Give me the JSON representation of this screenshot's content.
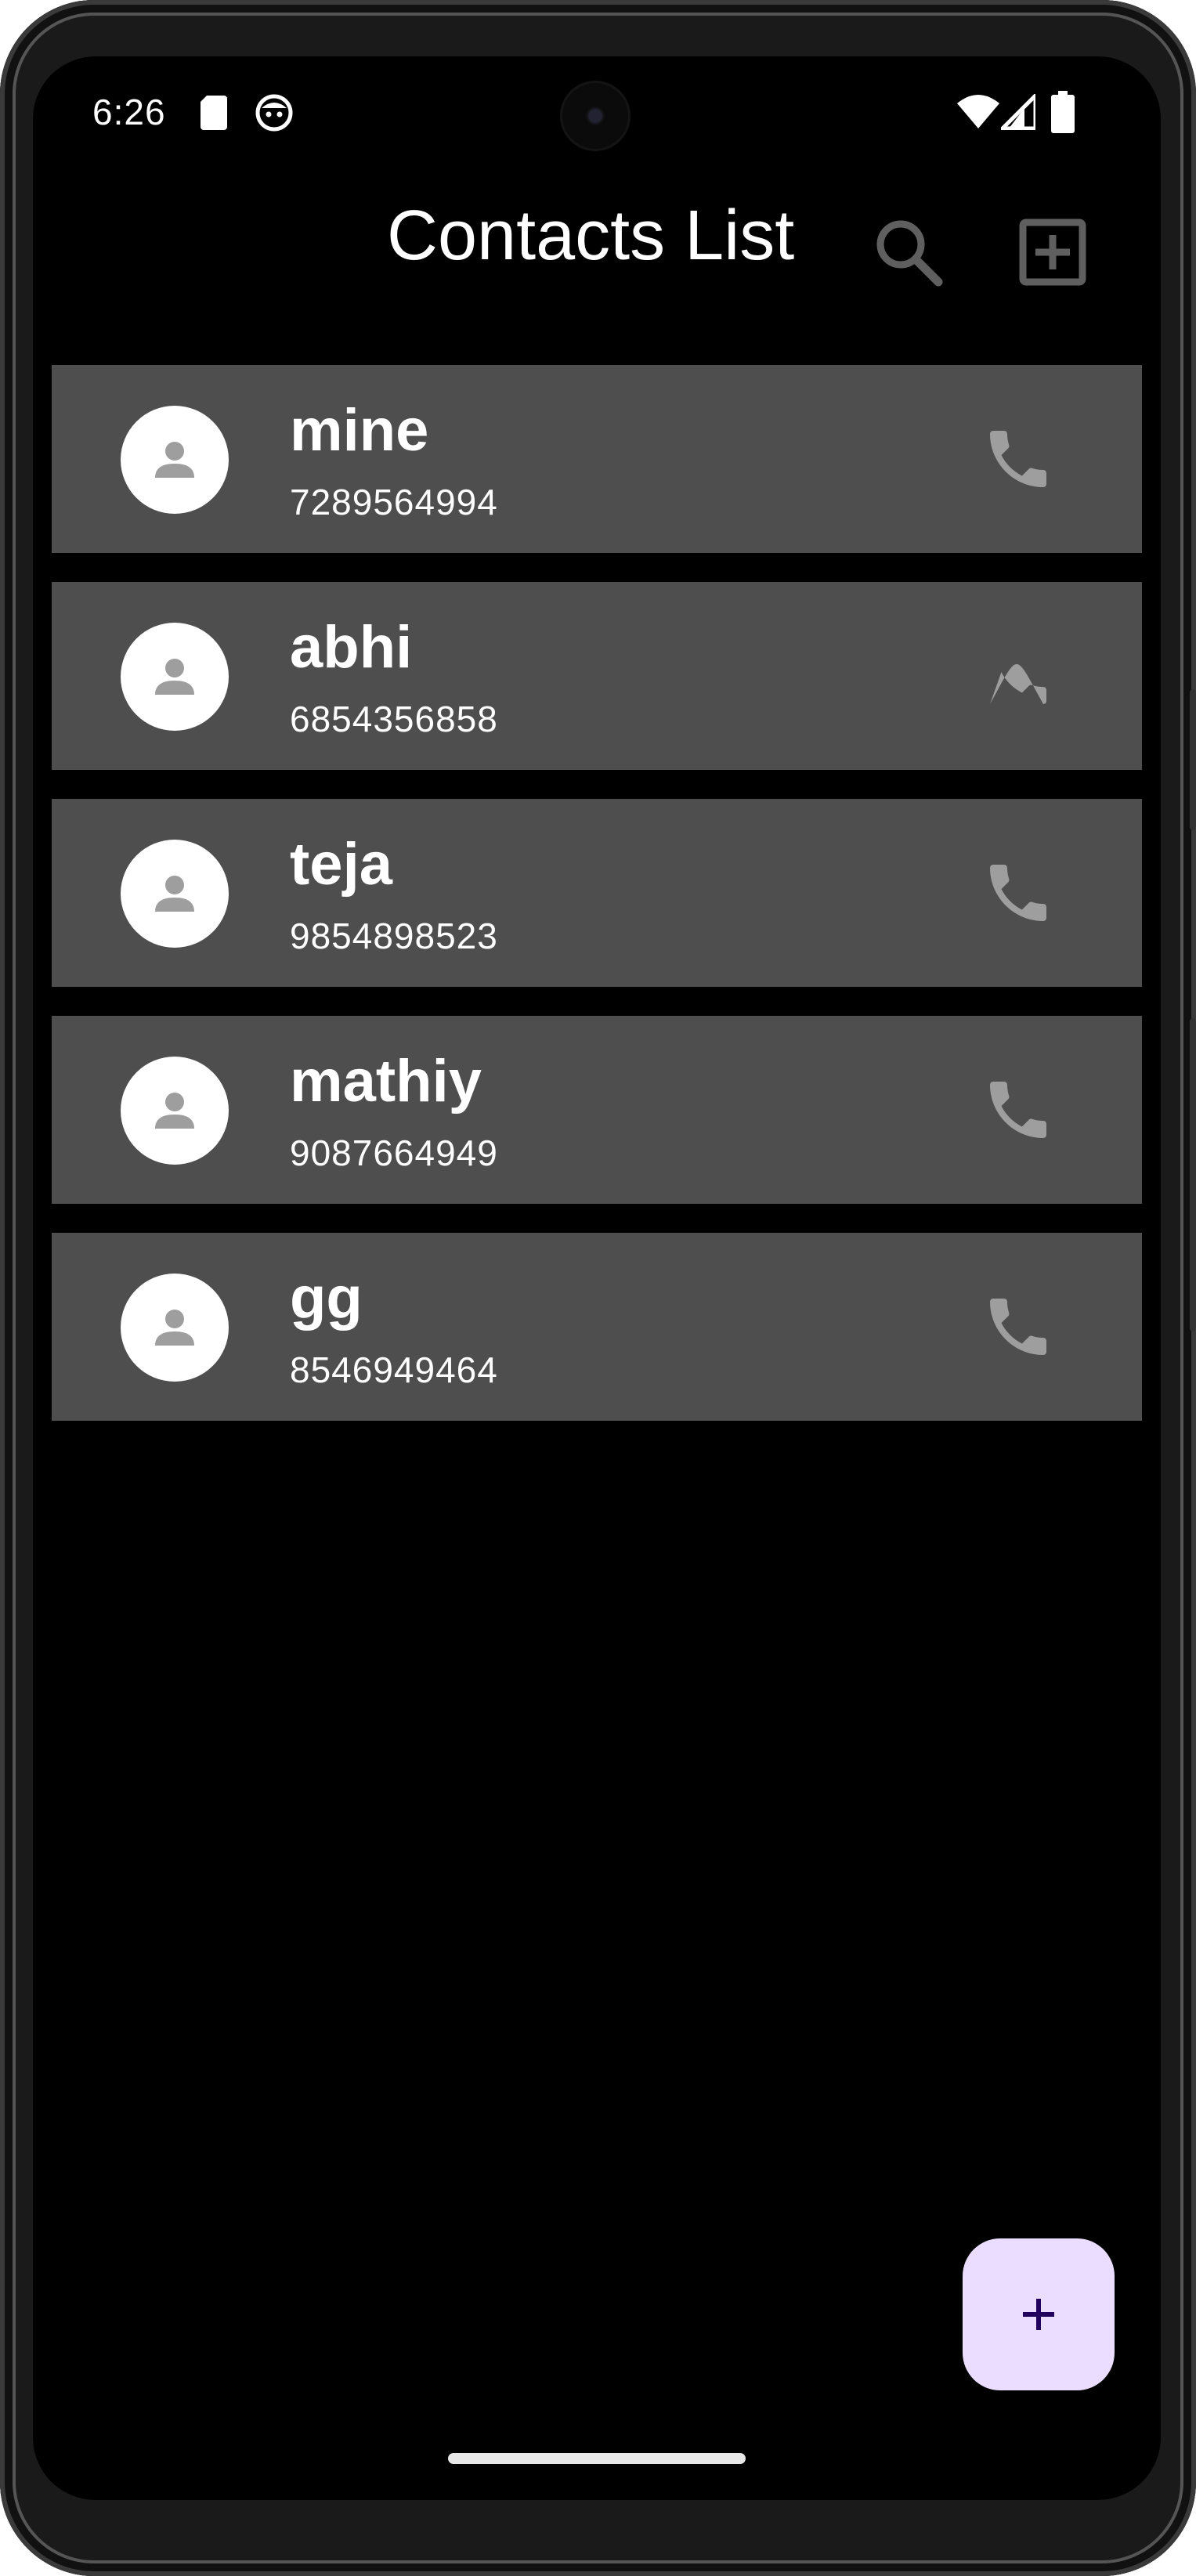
{
  "status_bar": {
    "time": "6:26",
    "icons": [
      "sd-card-icon",
      "face-icon",
      "wifi-icon",
      "cell-signal-icon",
      "battery-icon"
    ]
  },
  "app_bar": {
    "title": "Contacts List",
    "actions": [
      "search-icon",
      "add-box-icon"
    ]
  },
  "contacts": [
    {
      "name": "mine",
      "phone": "7289564994"
    },
    {
      "name": "abhi",
      "phone": "6854356858"
    },
    {
      "name": "teja",
      "phone": "9854898523"
    },
    {
      "name": "mathiy",
      "phone": "9087664949"
    },
    {
      "name": "gg",
      "phone": "8546949464"
    }
  ],
  "fab": {
    "icon": "plus-icon"
  },
  "colors": {
    "background": "#000000",
    "row_background": "#4e4e4e",
    "fab_background": "#eaddff",
    "fab_icon": "#21005d",
    "icon_gray": "#9e9e9e"
  }
}
